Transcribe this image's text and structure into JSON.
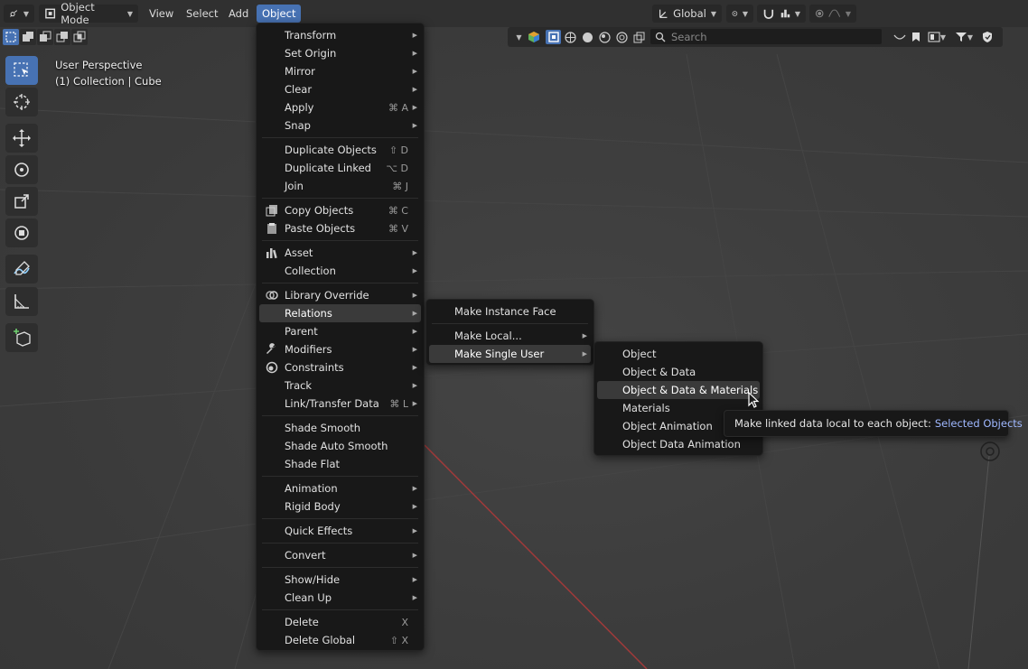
{
  "header": {
    "mode_label": "Object Mode",
    "menus": [
      "View",
      "Select",
      "Add",
      "Object"
    ],
    "transform_orientation": "Global"
  },
  "search": {
    "placeholder": "Search"
  },
  "viewport_info": {
    "line1": "User Perspective",
    "line2": "(1) Collection | Cube"
  },
  "object_menu": [
    {
      "label": "Transform",
      "submenu": true
    },
    {
      "label": "Set Origin",
      "submenu": true
    },
    {
      "label": "Mirror",
      "submenu": true
    },
    {
      "label": "Clear",
      "submenu": true
    },
    {
      "label": "Apply",
      "shortcut": "⌘ A",
      "submenu": true
    },
    {
      "label": "Snap",
      "submenu": true
    },
    {
      "label": "Duplicate Objects",
      "shortcut": "⇧ D"
    },
    {
      "label": "Duplicate Linked",
      "shortcut": "⌥ D"
    },
    {
      "label": "Join",
      "shortcut": "⌘ J"
    },
    {
      "label": "Copy Objects",
      "shortcut": "⌘ C"
    },
    {
      "label": "Paste Objects",
      "shortcut": "⌘ V"
    },
    {
      "label": "Asset",
      "submenu": true
    },
    {
      "label": "Collection",
      "submenu": true
    },
    {
      "label": "Library Override",
      "submenu": true
    },
    {
      "label": "Relations",
      "submenu": true
    },
    {
      "label": "Parent",
      "submenu": true
    },
    {
      "label": "Modifiers",
      "submenu": true
    },
    {
      "label": "Constraints",
      "submenu": true
    },
    {
      "label": "Track",
      "submenu": true
    },
    {
      "label": "Link/Transfer Data",
      "shortcut": "⌘ L",
      "submenu": true
    },
    {
      "label": "Shade Smooth"
    },
    {
      "label": "Shade Auto Smooth"
    },
    {
      "label": "Shade Flat"
    },
    {
      "label": "Animation",
      "submenu": true
    },
    {
      "label": "Rigid Body",
      "submenu": true
    },
    {
      "label": "Quick Effects",
      "submenu": true
    },
    {
      "label": "Convert",
      "submenu": true
    },
    {
      "label": "Show/Hide",
      "submenu": true
    },
    {
      "label": "Clean Up",
      "submenu": true
    },
    {
      "label": "Delete",
      "shortcut": "X"
    },
    {
      "label": "Delete Global",
      "shortcut": "⇧ X"
    }
  ],
  "relations_menu": [
    {
      "label": "Make Instance Face"
    },
    {
      "label": "Make Local...",
      "submenu": true
    },
    {
      "label": "Make Single User",
      "submenu": true
    }
  ],
  "single_user_menu": [
    {
      "label": "Object"
    },
    {
      "label": "Object & Data"
    },
    {
      "label": "Object & Data & Materials"
    },
    {
      "label": "Materials"
    },
    {
      "label": "Object Animation"
    },
    {
      "label": "Object Data Animation"
    }
  ],
  "tooltip": {
    "text": "Make linked data local to each object:",
    "value": "Selected Objects"
  },
  "colors": {
    "accent": "#4772b3",
    "menu_bg": "#181818",
    "header_bg": "#303030",
    "axis_red": "#a03a3a"
  }
}
